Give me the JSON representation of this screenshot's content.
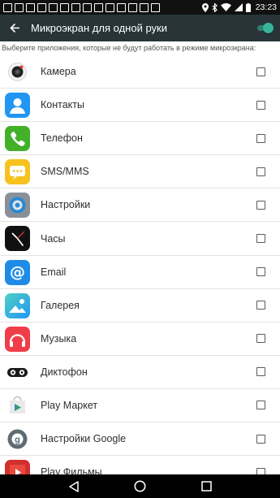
{
  "status_bar": {
    "time": "23:23",
    "notification_count": 14,
    "icons": [
      "location-icon",
      "bluetooth-icon",
      "wifi-icon",
      "signal-icon",
      "battery-icon"
    ]
  },
  "app_bar": {
    "title": "Микроэкран для одной руки",
    "back_icon": "arrow-back-icon",
    "toggle_on": true
  },
  "subtitle": "Выберите приложения, которые не будут работать в режиме микроэкрана:",
  "apps": [
    {
      "label": "Камера",
      "icon": "camera-icon",
      "checked": false
    },
    {
      "label": "Контакты",
      "icon": "contacts-icon",
      "checked": false
    },
    {
      "label": "Телефон",
      "icon": "phone-icon",
      "checked": false
    },
    {
      "label": "SMS/MMS",
      "icon": "sms-icon",
      "checked": false
    },
    {
      "label": "Настройки",
      "icon": "settings-icon",
      "checked": false
    },
    {
      "label": "Часы",
      "icon": "clock-icon",
      "checked": false
    },
    {
      "label": "Email",
      "icon": "email-icon",
      "checked": false
    },
    {
      "label": "Галерея",
      "icon": "gallery-icon",
      "checked": false
    },
    {
      "label": "Музыка",
      "icon": "music-icon",
      "checked": false
    },
    {
      "label": "Диктофон",
      "icon": "recorder-icon",
      "checked": false
    },
    {
      "label": "Play Маркет",
      "icon": "play-store-icon",
      "checked": false
    },
    {
      "label": "Настройки Google",
      "icon": "google-settings-icon",
      "checked": false
    },
    {
      "label": "Play Фильмы",
      "icon": "play-movies-icon",
      "checked": false
    }
  ],
  "nav_bar": {
    "icons": [
      "nav-back-icon",
      "nav-home-icon",
      "nav-recents-icon"
    ]
  },
  "colors": {
    "app_bar": "#283438",
    "accent": "#36b39a"
  }
}
